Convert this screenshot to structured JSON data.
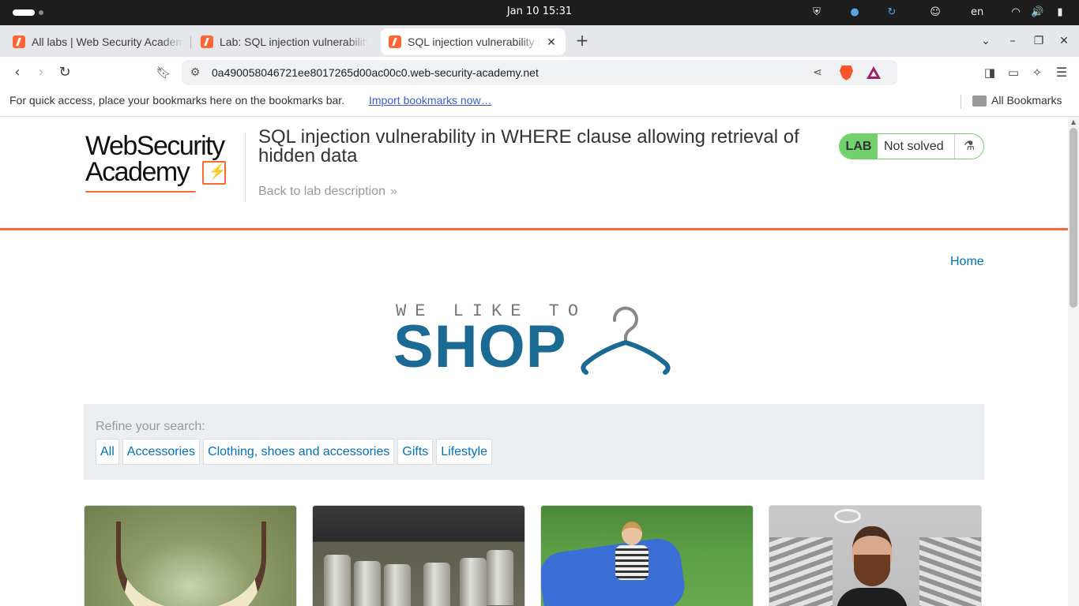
{
  "os": {
    "clock": "Jan 10  15:31",
    "lang": "en",
    "tray_icons": [
      "shield-icon",
      "vpn-globe-icon",
      "refresh-icon",
      "accessibility-icon",
      "wifi-icon",
      "volume-icon",
      "battery-icon"
    ]
  },
  "browser": {
    "tabs": [
      {
        "title": "All labs | Web Security Academy",
        "active": false
      },
      {
        "title": "Lab: SQL injection vulnerability in WHERE clause",
        "active": false
      },
      {
        "title": "SQL injection vulnerability in WHERE clause",
        "active": true
      }
    ],
    "new_tab": "+",
    "url": "0a490058046721ee8017265d00ac00c0.web-security-academy.net",
    "bookmarks_bar": {
      "message": "For quick access, place your bookmarks here on the bookmarks bar.",
      "import_link": "Import bookmarks now…",
      "all_bookmarks": "All Bookmarks"
    }
  },
  "page": {
    "logo": {
      "line1": "WebSecurity",
      "line2": "Academy"
    },
    "lab_title": "SQL injection vulnerability in WHERE clause allowing retrieval of hidden data",
    "back_link": "Back to lab description",
    "badge": {
      "label": "LAB",
      "status": "Not solved"
    },
    "nav": {
      "home": "Home"
    },
    "shop_logo": {
      "small": "WE LIKE TO",
      "big": "SHOP"
    },
    "refine": {
      "label": "Refine your search:",
      "filters": [
        "All",
        "Accessories",
        "Clothing, shoes and accessories",
        "Gifts",
        "Lifestyle"
      ]
    },
    "colors": {
      "accent": "#ff6633",
      "link": "#0071bc",
      "shop_blue": "#1b6a93",
      "lab_green": "#70d16d"
    }
  }
}
